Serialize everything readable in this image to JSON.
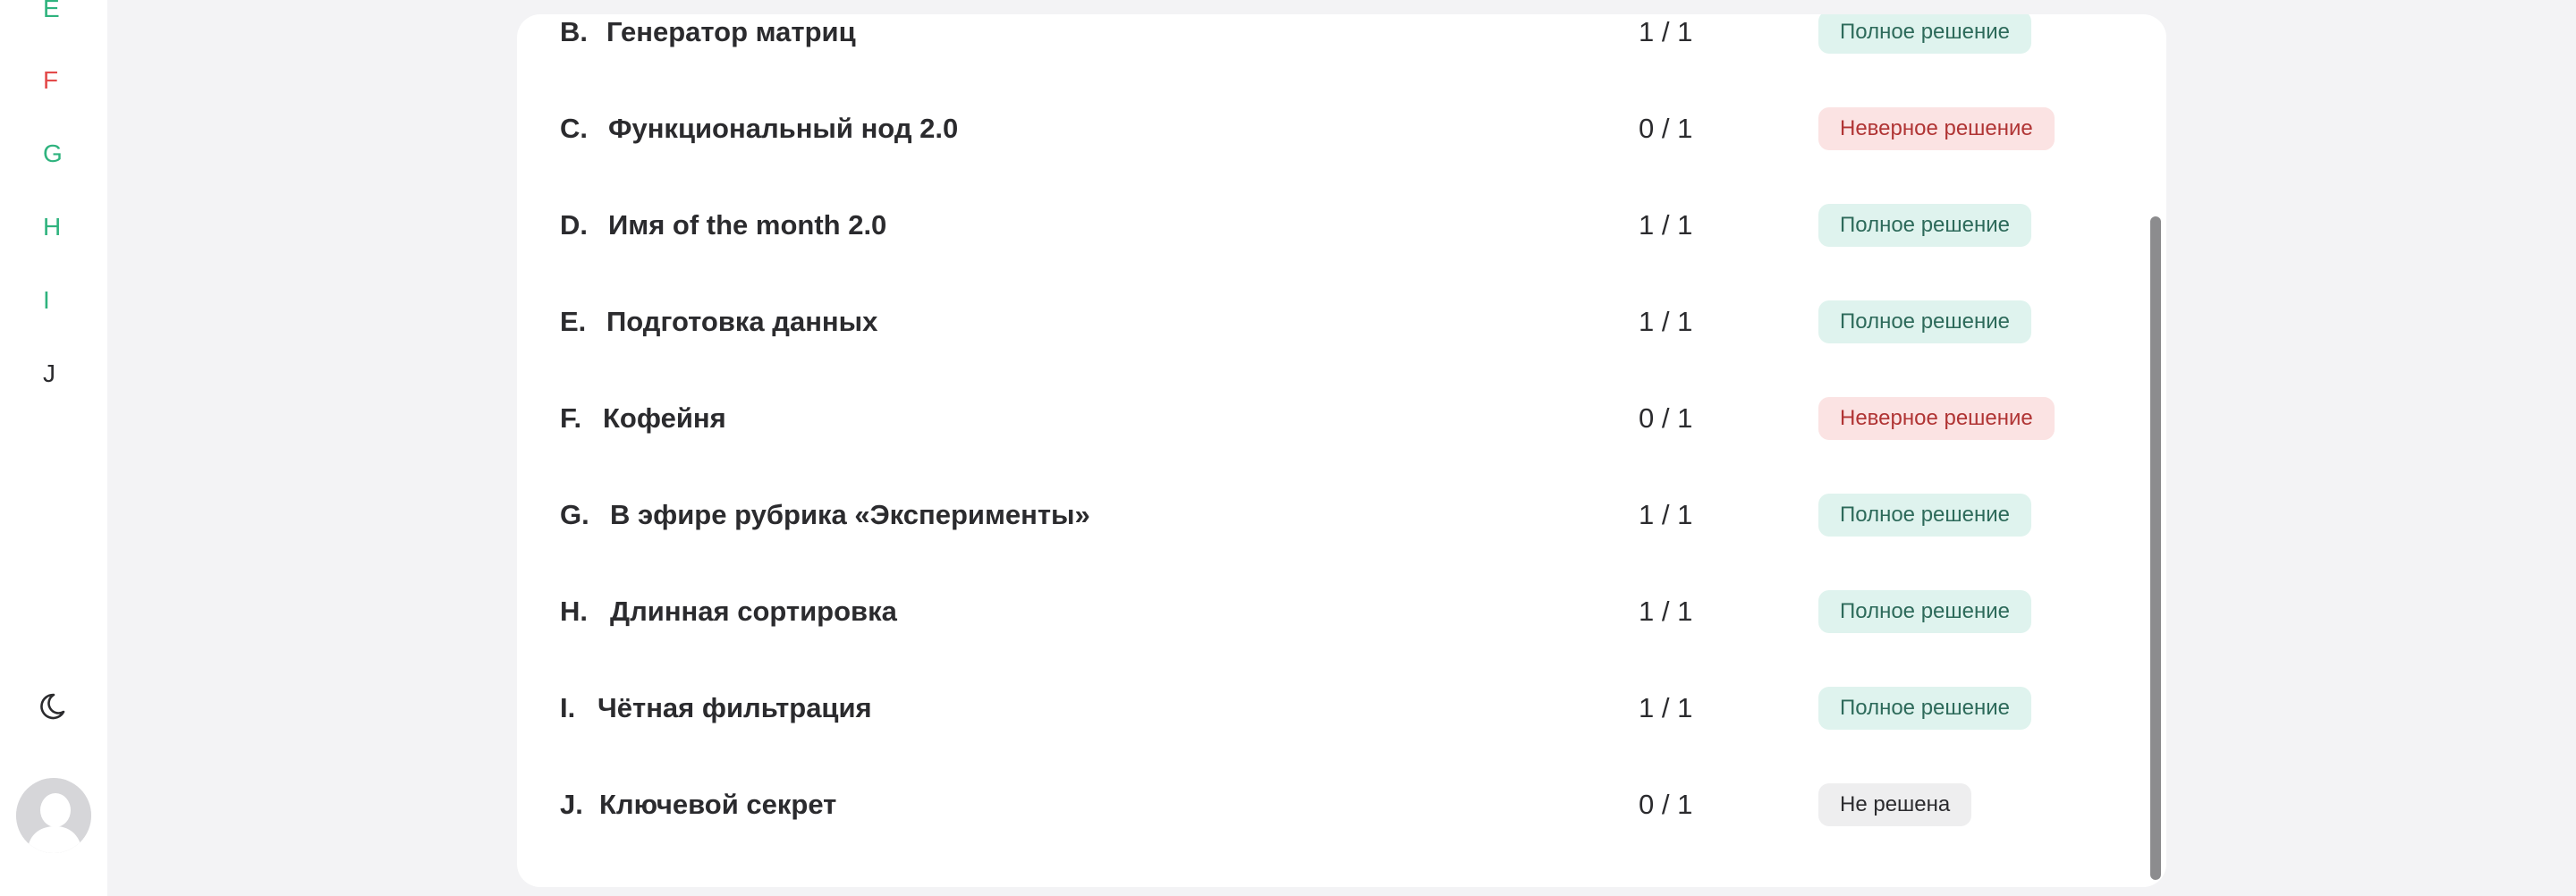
{
  "sidebar": {
    "letters": [
      {
        "label": "E",
        "color": "#2fb37e"
      },
      {
        "label": "F",
        "color": "#e34b4b"
      },
      {
        "label": "G",
        "color": "#2fb37e"
      },
      {
        "label": "H",
        "color": "#2fb37e"
      },
      {
        "label": "I",
        "color": "#2fb37e"
      },
      {
        "label": "J",
        "color": "#2b2b2e"
      }
    ],
    "theme_icon": "moon-icon",
    "avatar_icon": "user-avatar-icon"
  },
  "problems": [
    {
      "letter": "B.",
      "title": "Генератор матриц",
      "score": "1 / 1",
      "status": "Полное решение",
      "status_kind": "ok"
    },
    {
      "letter": "C.",
      "title": "Функциональный нод 2.0",
      "score": "0 / 1",
      "status": "Неверное решение",
      "status_kind": "wrong"
    },
    {
      "letter": "D.",
      "title": "Имя of the month 2.0",
      "score": "1 / 1",
      "status": "Полное решение",
      "status_kind": "ok"
    },
    {
      "letter": "E.",
      "title": "Подготовка данных",
      "score": "1 / 1",
      "status": "Полное решение",
      "status_kind": "ok"
    },
    {
      "letter": "F.",
      "title": "Кофейня",
      "score": "0 / 1",
      "status": "Неверное решение",
      "status_kind": "wrong"
    },
    {
      "letter": "G.",
      "title": "В эфире рубрика «Эксперименты»",
      "score": "1 / 1",
      "status": "Полное решение",
      "status_kind": "ok"
    },
    {
      "letter": "H.",
      "title": "Длинная сортировка",
      "score": "1 / 1",
      "status": "Полное решение",
      "status_kind": "ok"
    },
    {
      "letter": "I.",
      "title": "Чётная фильтрация",
      "score": "1 / 1",
      "status": "Полное решение",
      "status_kind": "ok"
    },
    {
      "letter": "J.",
      "title": "Ключевой секрет",
      "score": "0 / 1",
      "status": "Не решена",
      "status_kind": "none"
    }
  ]
}
